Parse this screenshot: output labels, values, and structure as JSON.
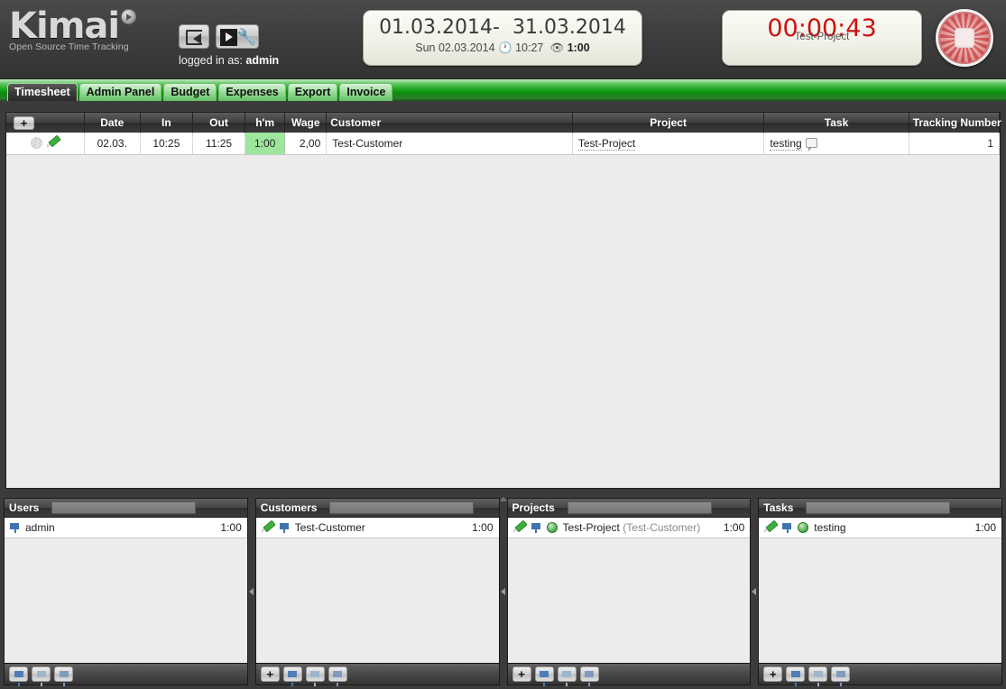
{
  "app": {
    "logo_text": "Kimai",
    "logo_tagline": "Open Source Time Tracking",
    "logged_in_label": "logged in as:",
    "logged_in_user": "admin"
  },
  "header_buttons": [
    {
      "name": "logout-button",
      "title": "logout"
    },
    {
      "name": "preferences-button",
      "title": "preferences"
    }
  ],
  "date_panel": {
    "range": "01.03.2014-  31.03.2014",
    "day": "Sun 02.03.2014",
    "clock_icon": "clock-icon",
    "time": "10:27",
    "eye_icon": "eye-icon",
    "duration": "1:00"
  },
  "timer": {
    "value": "00:00:43",
    "project": "Test-Project",
    "stop_label": "stop-recording"
  },
  "tabs": [
    {
      "label": "Timesheet",
      "active": true
    },
    {
      "label": "Admin Panel",
      "active": false
    },
    {
      "label": "Budget",
      "active": false
    },
    {
      "label": "Expenses",
      "active": false
    },
    {
      "label": "Export",
      "active": false
    },
    {
      "label": "Invoice",
      "active": false
    }
  ],
  "timesheet": {
    "add_button_label": "+",
    "columns": [
      "Date",
      "In",
      "Out",
      "h'm",
      "Wage",
      "Customer",
      "Project",
      "Task",
      "Tracking Number"
    ],
    "rows": [
      {
        "date": "02.03.",
        "in": "10:25",
        "out": "11:25",
        "hm": "1:00",
        "wage": "2,00",
        "customer": "Test-Customer",
        "project": "Test-Project",
        "task": "testing",
        "tracking_number": "1"
      }
    ]
  },
  "panels": [
    {
      "title": "Users",
      "search_placeholder": "",
      "search_value": "",
      "rows": [
        {
          "icons": [
            "filter"
          ],
          "label": "admin",
          "sub": "",
          "time": "1:00"
        }
      ],
      "footer_buttons": [
        "filter",
        "filter-dim",
        "filter-dim2"
      ]
    },
    {
      "title": "Customers",
      "search_placeholder": "",
      "search_value": "",
      "rows": [
        {
          "icons": [
            "pencil",
            "filter"
          ],
          "label": "Test-Customer",
          "sub": "",
          "time": "1:00"
        }
      ],
      "footer_buttons": [
        "add",
        "filter",
        "filter-dim",
        "filter-dim2"
      ]
    },
    {
      "title": "Projects",
      "search_placeholder": "",
      "search_value": "",
      "rows": [
        {
          "icons": [
            "pencil",
            "filter",
            "circle"
          ],
          "label": "Test-Project",
          "sub": "(Test-Customer)",
          "time": "1:00"
        }
      ],
      "footer_buttons": [
        "add",
        "filter",
        "filter-dim",
        "filter-dim2"
      ]
    },
    {
      "title": "Tasks",
      "search_placeholder": "",
      "search_value": "",
      "rows": [
        {
          "icons": [
            "pencil",
            "filter",
            "circle"
          ],
          "label": "testing",
          "sub": "",
          "time": "1:00"
        }
      ],
      "footer_buttons": [
        "add",
        "filter",
        "filter-dim",
        "filter-dim2"
      ]
    }
  ],
  "colors": {
    "accent_green": "#16a016",
    "timer_red": "#cc1111",
    "highlight_green": "#9ee69e",
    "panel_dark": "#3c3c3c"
  }
}
